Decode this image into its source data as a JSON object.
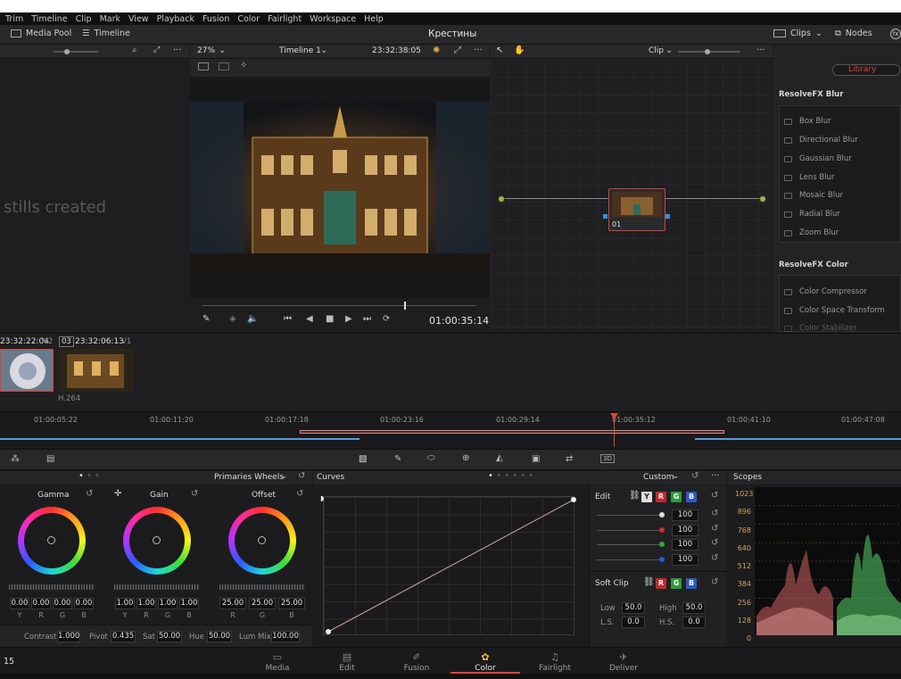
{
  "menu": [
    "Trim",
    "Timeline",
    "Clip",
    "Mark",
    "View",
    "Playback",
    "Fusion",
    "Color",
    "Fairlight",
    "Workspace",
    "Help"
  ],
  "toolbar": {
    "media_pool": "Media Pool",
    "timeline": "Timeline",
    "project_title": "Крестины",
    "clips": "Clips",
    "nodes": "Nodes"
  },
  "viewer": {
    "zoom": "27%",
    "timeline_name": "Timeline 1",
    "timecode": "23:32:38:05",
    "playhead_tc": "01:00:35:14"
  },
  "node_editor": {
    "mode": "Clip",
    "node_label": "01"
  },
  "gallery": {
    "empty_text": "stills created"
  },
  "library": {
    "tab": "Library",
    "sections": [
      {
        "title": "ResolveFX Blur",
        "items": [
          "Box Blur",
          "Directional Blur",
          "Gaussian Blur",
          "Lens Blur",
          "Mosaic Blur",
          "Radial Blur",
          "Zoom Blur"
        ]
      },
      {
        "title": "ResolveFX Color",
        "items": [
          "Color Compressor",
          "Color Space Transform",
          "Color Stabilizer"
        ]
      }
    ]
  },
  "clips": {
    "clip1_tc": "23:32:22:04",
    "clip1_track": "V2",
    "clip2_num": "03",
    "clip2_tc": "23:32:06:13",
    "clip2_track": "V1",
    "codec": "H.264"
  },
  "ruler": [
    "01:00:05:22",
    "01:00:11:20",
    "01:00:17:18",
    "01:00:23:16",
    "01:00:29:14",
    "01:00:35:12",
    "01:00:41:10",
    "01:00:47:08"
  ],
  "wheels": {
    "mode": "Primaries Wheels",
    "gamma": {
      "label": "Gamma",
      "values": [
        "0.00",
        "0.00",
        "0.00",
        "0.00"
      ],
      "channels": [
        "Y",
        "R",
        "G",
        "B"
      ]
    },
    "gain": {
      "label": "Gain",
      "values": [
        "1.00",
        "1.00",
        "1.00",
        "1.00"
      ],
      "channels": [
        "Y",
        "R",
        "G",
        "B"
      ]
    },
    "offset": {
      "label": "Offset",
      "values": [
        "25.00",
        "25.00",
        "25.00"
      ],
      "channels": [
        "R",
        "G",
        "B"
      ]
    },
    "contrast_label": "Contrast",
    "contrast": "1.000",
    "pivot_label": "Pivot",
    "pivot": "0.435",
    "sat_label": "Sat",
    "sat": "50.00",
    "hue_label": "Hue",
    "hue": "50.00",
    "lummix_label": "Lum Mix",
    "lummix": "100.00"
  },
  "curves": {
    "title": "Curves",
    "mode": "Custom",
    "edit_label": "Edit",
    "channel_values": [
      "100",
      "100",
      "100",
      "100"
    ],
    "soft_clip_label": "Soft Clip",
    "low_label": "Low",
    "low": "50.0",
    "high_label": "High",
    "high": "50.0",
    "ls_label": "L.S.",
    "ls": "0.0",
    "hs_label": "H.S.",
    "hs": "0.0",
    "ch_y": "Y",
    "ch_r": "R",
    "ch_g": "G",
    "ch_b": "B"
  },
  "scopes": {
    "title": "Scopes",
    "ticks": [
      "1023",
      "896",
      "768",
      "640",
      "512",
      "384",
      "256",
      "128",
      "0"
    ]
  },
  "bottom_nav": {
    "left_num": "15",
    "items": [
      "Media",
      "Edit",
      "Fusion",
      "Color",
      "Fairlight",
      "Deliver"
    ],
    "active": "Color"
  },
  "colors": {
    "accent_red": "#e0453b",
    "panel": "#28282b",
    "bg": "#1c1c1e"
  }
}
